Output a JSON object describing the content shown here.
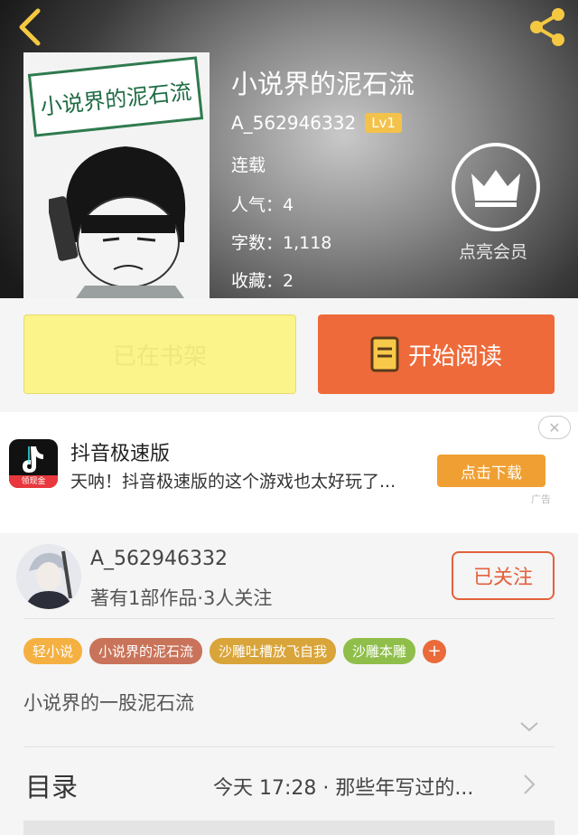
{
  "header": {
    "book_title": "小说界的泥石流",
    "cover_title": "小说界的泥石流",
    "author": "A_562946332",
    "level": "Lv1",
    "status": "连载",
    "popularity": "人气：4",
    "word_count": "字数：1,118",
    "favorites": "收藏：2",
    "vip_label": "点亮会员"
  },
  "actions": {
    "shelf_label": "已在书架",
    "read_label": "开始阅读"
  },
  "ad": {
    "logo_tag": "领现金",
    "title": "抖音极速版",
    "description": "天呐！抖音极速版的这个游戏也太好玩了...",
    "button_label": "点击下载",
    "close_glyph": "✕",
    "ad_mark": "广告"
  },
  "author_card": {
    "name": "A_562946332",
    "summary": "著有1部作品·3人关注",
    "follow_label": "已关注"
  },
  "tags": [
    {
      "label": "轻小说",
      "color": "#f5b042"
    },
    {
      "label": "小说界的泥石流",
      "color": "#c9735a"
    },
    {
      "label": "沙雕吐槽放飞自我",
      "color": "#d9a43a"
    },
    {
      "label": "沙雕本雕",
      "color": "#8fbf4a"
    }
  ],
  "tag_plus": "+",
  "intro": "小说界的一股泥石流",
  "toc": {
    "label": "目录",
    "latest": "今天 17:28 · 那些年写过的..."
  },
  "colors": {
    "accent": "#ef6a3a",
    "shelf_bg": "#fbf48a",
    "level_badge": "#f3c24a",
    "follow": "#e3603c"
  }
}
